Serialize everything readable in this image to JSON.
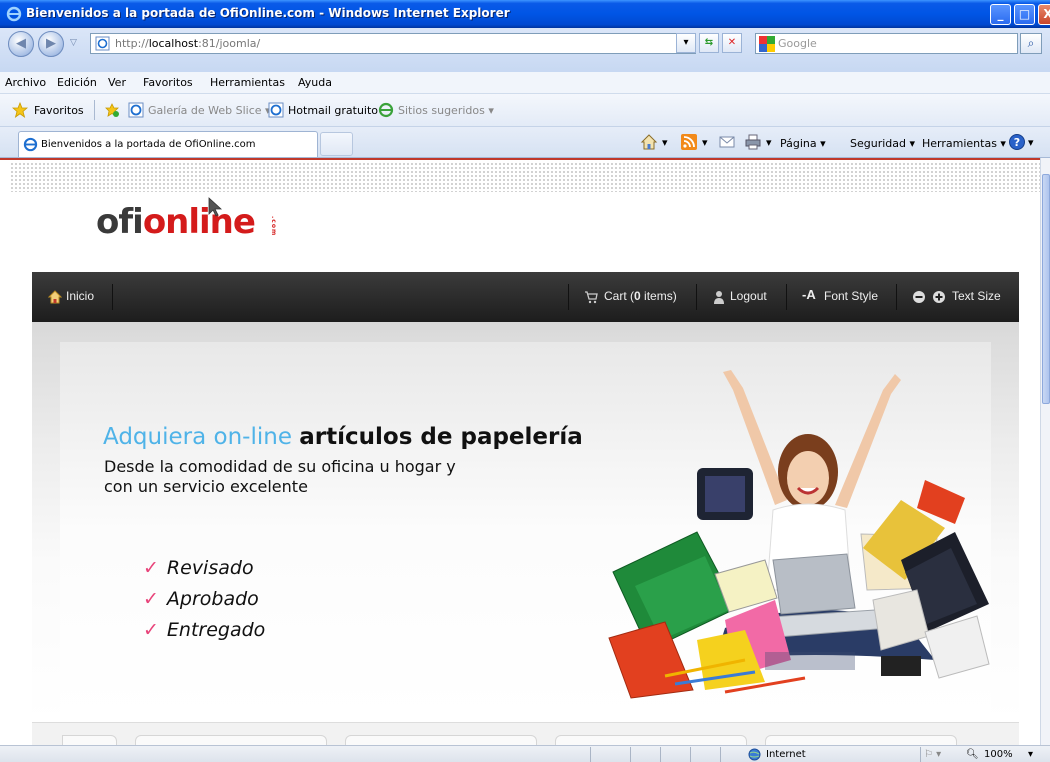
{
  "window": {
    "title": "Bienvenidos a la portada de OfiOnline.com - Windows Internet Explorer",
    "min_label": "_",
    "max_label": "□",
    "close_label": "X"
  },
  "address": {
    "url_prefix": "http://",
    "url_host": "localhost",
    "url_rest": ":81/joomla/",
    "search_placeholder": "Google"
  },
  "menu": [
    "Archivo",
    "Edición",
    "Ver",
    "Favoritos",
    "Herramientas",
    "Ayuda"
  ],
  "favorites": {
    "label": "Favoritos",
    "items": [
      "Galería de Web Slice ▾",
      "Hotmail gratuito",
      "Sitios sugeridos ▾"
    ]
  },
  "tabs": {
    "active_label": "Bienvenidos a la portada de OfiOnline.com"
  },
  "commands": [
    "Página ▾",
    "Seguridad ▾",
    "Herramientas ▾"
  ],
  "site": {
    "logo_ofi": "ofi",
    "logo_online": "online",
    "logo_com": ".com",
    "nav": {
      "home": "Inicio",
      "cart_prefix": "Cart (",
      "cart_count": "0",
      "cart_suffix": " items)",
      "logout": "Logout",
      "font_style": "Font Style",
      "text_size": "Text Size"
    },
    "banner": {
      "headline_blue": "Adquiera on-line",
      "headline_dark": "artículos de papelería",
      "sub_line1": "Desde la comodidad de su oficina u hogar y",
      "sub_line2": "con un servicio excelente",
      "checks": [
        "Revisado",
        "Aprobado",
        "Entregado"
      ]
    }
  },
  "status": {
    "zone": "Internet",
    "zoom": "100%"
  },
  "colors": {
    "brand_red": "#d41b1b",
    "headline_blue": "#4fb3e8",
    "check_pink": "#e8447a",
    "nav_dark": "#1d1d1d"
  }
}
